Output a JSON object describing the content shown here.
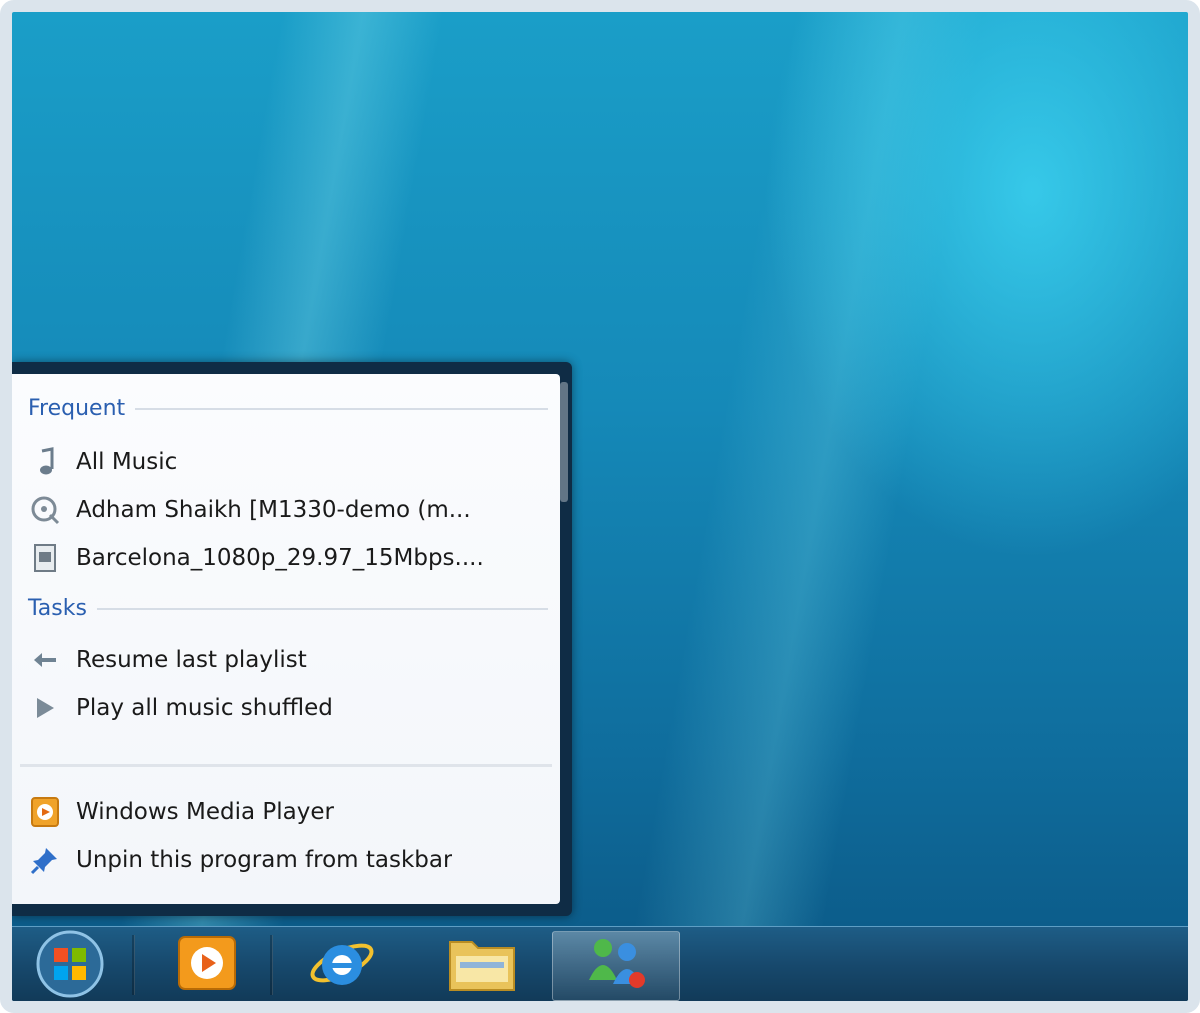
{
  "jumplist": {
    "frequent_header": "Frequent",
    "frequent_items": [
      {
        "label": "All Music",
        "icon": "music-note-icon"
      },
      {
        "label": "Adham Shaikh [M1330-demo (m...",
        "icon": "playlist-disc-icon"
      },
      {
        "label": "Barcelona_1080p_29.97_15Mbps....",
        "icon": "video-file-icon"
      }
    ],
    "tasks_header": "Tasks",
    "task_items": [
      {
        "label": "Resume last playlist",
        "icon": "resume-playlist-icon"
      },
      {
        "label": "Play all music shuffled",
        "icon": "shuffle-play-icon"
      }
    ],
    "app_items": [
      {
        "label": "Windows Media Player",
        "icon": "media-player-icon"
      },
      {
        "label": "Unpin this program from taskbar",
        "icon": "unpin-icon"
      }
    ]
  },
  "taskbar": {
    "buttons": [
      {
        "icon": "start-orb-icon"
      },
      {
        "icon": "media-player-icon"
      },
      {
        "icon": "internet-explorer-icon"
      },
      {
        "icon": "folder-icon"
      },
      {
        "icon": "messenger-icon"
      }
    ]
  },
  "colors": {
    "header_blue": "#2a5fb0",
    "taskbar": "#17496d",
    "desktop": "#1589b8"
  }
}
